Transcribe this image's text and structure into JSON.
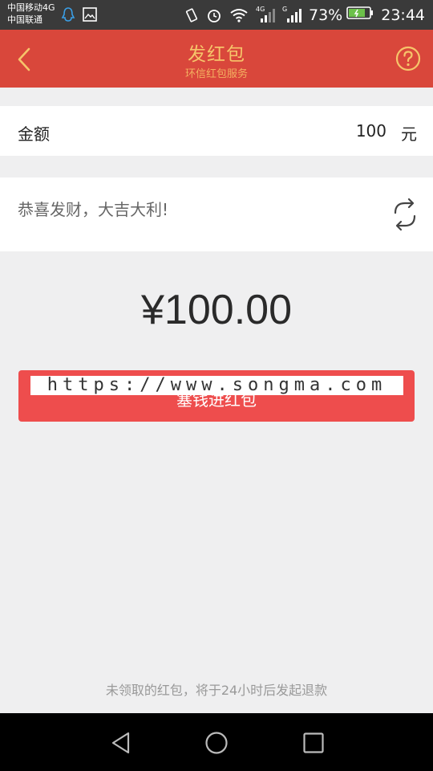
{
  "status_bar": {
    "carrier_1": "中国移动4G",
    "carrier_2": "中国联通",
    "net_4g": "4G",
    "net_g": "G",
    "battery_percent": "73%",
    "time": "23:44"
  },
  "header": {
    "title": "发红包",
    "subtitle": "环信红包服务"
  },
  "amount": {
    "label": "金额",
    "value": "100",
    "unit": "元"
  },
  "greeting": {
    "text": "恭喜发财，大吉大利!"
  },
  "display_amount": "¥100.00",
  "send_button": {
    "label": "塞钱进红包"
  },
  "watermark": "https://www.songma.com",
  "footnote": "未领取的红包，将于24小时后发起退款",
  "colors": {
    "header_bg": "#d9473b",
    "title": "#f6c46a",
    "button_bg": "#ee4d4d",
    "page_bg": "#efeff0"
  },
  "icons": {
    "back": "chevron-left-icon",
    "help": "question-circle-icon",
    "refresh": "refresh-icon",
    "nav_back": "triangle-back-icon",
    "nav_home": "circle-home-icon",
    "nav_recent": "square-recent-icon"
  }
}
